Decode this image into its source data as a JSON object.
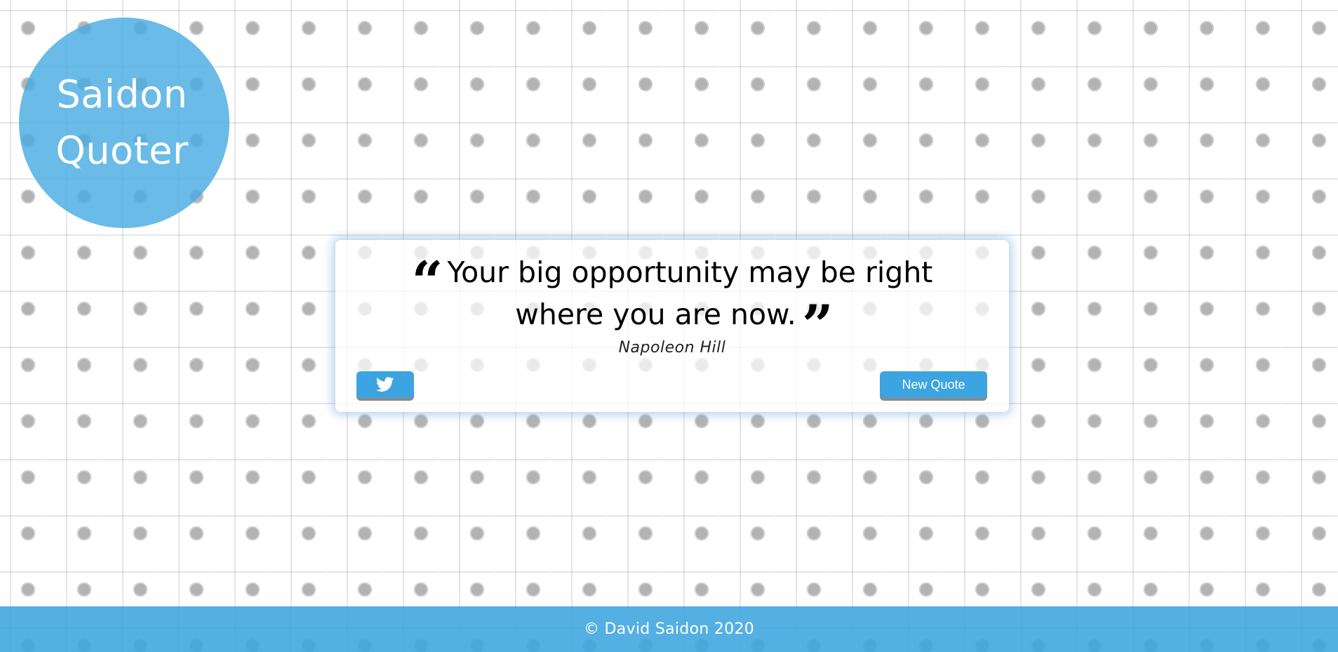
{
  "logo": {
    "line1": "Saidon",
    "line2": "Quoter"
  },
  "quote": {
    "open_mark": "“",
    "text": "Your big opportunity may be right where you are now.",
    "close_mark": "”",
    "author": "Napoleon Hill"
  },
  "actions": {
    "tweet_icon": "twitter-icon",
    "new_quote_label": "New Quote"
  },
  "footer": {
    "text": "© David Saidon 2020"
  },
  "colors": {
    "accent": "#3ca4e0",
    "logo_circle": "#49ace2",
    "footer": "#3ca5de"
  }
}
